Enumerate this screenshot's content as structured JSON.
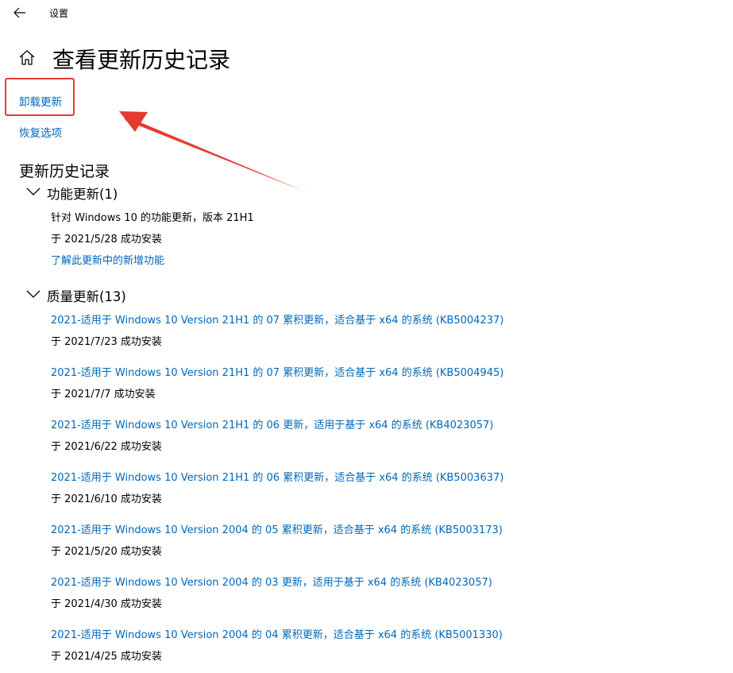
{
  "window": {
    "title": "设置"
  },
  "page": {
    "title": "查看更新历史记录"
  },
  "actions": {
    "uninstall": "卸载更新",
    "recovery": "恢复选项"
  },
  "history": {
    "heading": "更新历史记录",
    "feature_group": {
      "label": "功能更新(1)",
      "items": [
        {
          "title": "针对 Windows 10 的功能更新，版本 21H1",
          "date": "于 2021/5/28 成功安装",
          "link": "了解此更新中的新增功能"
        }
      ]
    },
    "quality_group": {
      "label": "质量更新(13)",
      "items": [
        {
          "title": "2021-适用于 Windows 10 Version 21H1 的 07 累积更新，适合基于 x64 的系统 (KB5004237)",
          "date": "于 2021/7/23 成功安装"
        },
        {
          "title": "2021-适用于 Windows 10 Version 21H1 的 07 累积更新，适合基于 x64 的系统 (KB5004945)",
          "date": "于 2021/7/7 成功安装"
        },
        {
          "title": "2021-适用于 Windows 10 Version 21H1 的 06 更新，适用于基于 x64 的系统 (KB4023057)",
          "date": "于 2021/6/22 成功安装"
        },
        {
          "title": "2021-适用于 Windows 10 Version 21H1 的 06 累积更新，适合基于 x64 的系统 (KB5003637)",
          "date": "于 2021/6/10 成功安装"
        },
        {
          "title": "2021-适用于 Windows 10 Version 2004 的 05 累积更新，适合基于 x64 的系统 (KB5003173)",
          "date": "于 2021/5/20 成功安装"
        },
        {
          "title": "2021-适用于 Windows 10 Version 2004 的 03 更新，适用于基于 x64 的系统 (KB4023057)",
          "date": "于 2021/4/30 成功安装"
        },
        {
          "title": "2021-适用于 Windows 10 Version 2004 的 04 累积更新，适合基于 x64 的系统 (KB5001330)",
          "date": "于 2021/4/25 成功安装"
        }
      ]
    }
  },
  "annotation": {
    "color": "#e53a30"
  },
  "colors": {
    "link": "#0067b8",
    "text": "#000000",
    "background": "#ffffff"
  },
  "icons": {
    "back": "back-arrow-icon",
    "home": "home-icon",
    "chevron": "chevron-down-icon"
  }
}
